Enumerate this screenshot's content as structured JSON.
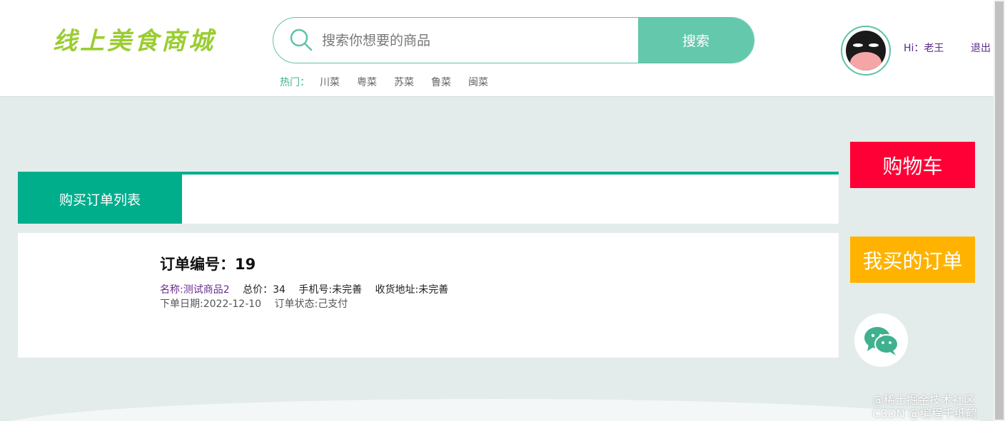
{
  "header": {
    "logo_text": "线上美食商城",
    "search": {
      "placeholder": "搜索你想要的商品",
      "value": "",
      "button_label": "搜索"
    },
    "hot": {
      "label": "热门：",
      "items": [
        "川菜",
        "粤菜",
        "苏菜",
        "鲁菜",
        "闽菜"
      ]
    },
    "user": {
      "greeting": "Hi：老王",
      "logout_label": "退出"
    }
  },
  "tabs": {
    "active_label": "购买订单列表"
  },
  "order": {
    "title": "订单编号：19",
    "name": "名称:测试商品2",
    "total": "总价：34",
    "phone": "手机号:未完善",
    "address": "收货地址:未完善",
    "date": "下单日期:2022-12-10",
    "status": "订单状态:己支付"
  },
  "side": {
    "cart_label": "购物车",
    "my_orders_label": "我买的订单",
    "wechat_icon": "wechat-icon"
  },
  "watermark": {
    "line1": "@稀土掘金技术社区",
    "line2": "CSDN @编程千纸鹤"
  },
  "colors": {
    "accent": "#00ae8c",
    "search_button": "#64c8ad",
    "cart": "#ff0036",
    "orders": "#ffb300",
    "logo": "#9acd32"
  }
}
